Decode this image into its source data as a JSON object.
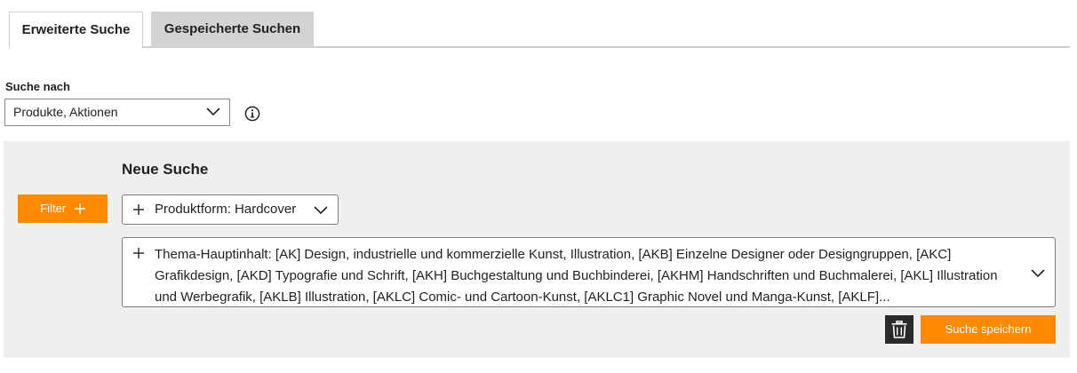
{
  "tabs": [
    {
      "label": "Erweiterte Suche",
      "active": true
    },
    {
      "label": "Gespeicherte Suchen",
      "active": false
    }
  ],
  "search_by": {
    "label": "Suche nach",
    "selected": "Produkte, Aktionen"
  },
  "panel": {
    "title": "Neue Suche",
    "filter_button": "Filter",
    "filters": [
      {
        "label": "Produktform: Hardcover"
      },
      {
        "label": "Thema-Hauptinhalt: [AK] Design, industrielle und kommerzielle Kunst, Illustration, [AKB] Einzelne Designer oder Designgruppen, [AKC] Grafikdesign, [AKD] Typografie und Schrift, [AKH] Buchgestaltung und Buchbinderei, [AKHM] Handschriften und Buchmalerei, [AKL] Illustration und Werbegrafik, [AKLB] Illustration, [AKLC] Comic- und Cartoon-Kunst, [AKLC1] Graphic Novel und Manga-Kunst, [AKLF]..."
      }
    ],
    "save_button": "Suche speichern"
  },
  "colors": {
    "accent": "#ff8a00",
    "panel_bg": "#efefef",
    "inactive_tab": "#d3d3d3",
    "trash_bg": "#2a2a2a"
  },
  "icons": [
    "chevron-down-icon",
    "info-icon",
    "plus-icon",
    "trash-icon"
  ]
}
